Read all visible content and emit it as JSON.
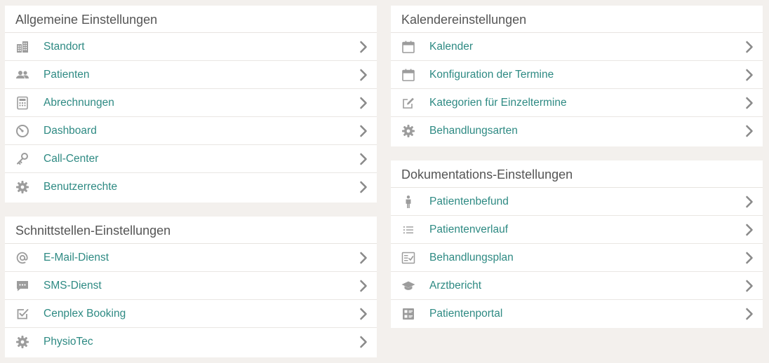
{
  "colors": {
    "background": "#f3f0ed",
    "link": "#2e8a83",
    "icon": "#9c9c9c",
    "header_text": "#555555"
  },
  "panels": {
    "general": {
      "title": "Allgemeine Einstellungen",
      "items": [
        {
          "label": "Standort",
          "icon": "building-icon"
        },
        {
          "label": "Patienten",
          "icon": "users-icon"
        },
        {
          "label": "Abrechnungen",
          "icon": "calculator-icon"
        },
        {
          "label": "Dashboard",
          "icon": "gauge-icon"
        },
        {
          "label": "Call-Center",
          "icon": "key-icon"
        },
        {
          "label": "Benutzerrechte",
          "icon": "gear-icon"
        }
      ]
    },
    "interfaces": {
      "title": "Schnittstellen-Einstellungen",
      "items": [
        {
          "label": "E-Mail-Dienst",
          "icon": "at-icon"
        },
        {
          "label": "SMS-Dienst",
          "icon": "message-icon"
        },
        {
          "label": "Cenplex Booking",
          "icon": "checkbox-icon"
        },
        {
          "label": "PhysioTec",
          "icon": "gear-icon"
        }
      ]
    },
    "calendar": {
      "title": "Kalendereinstellungen",
      "items": [
        {
          "label": "Kalender",
          "icon": "calendar-icon"
        },
        {
          "label": "Konfiguration der Termine",
          "icon": "calendar-icon"
        },
        {
          "label": "Kategorien für Einzeltermine",
          "icon": "edit-icon"
        },
        {
          "label": "Behandlungsarten",
          "icon": "gear-icon"
        }
      ]
    },
    "documentation": {
      "title": "Dokumentations-Einstellungen",
      "items": [
        {
          "label": "Patientenbefund",
          "icon": "person-icon"
        },
        {
          "label": "Patientenverlauf",
          "icon": "list-icon"
        },
        {
          "label": "Behandlungsplan",
          "icon": "checklist-icon"
        },
        {
          "label": "Arztbericht",
          "icon": "graduation-cap-icon"
        },
        {
          "label": "Patientenportal",
          "icon": "portal-icon"
        }
      ]
    }
  }
}
